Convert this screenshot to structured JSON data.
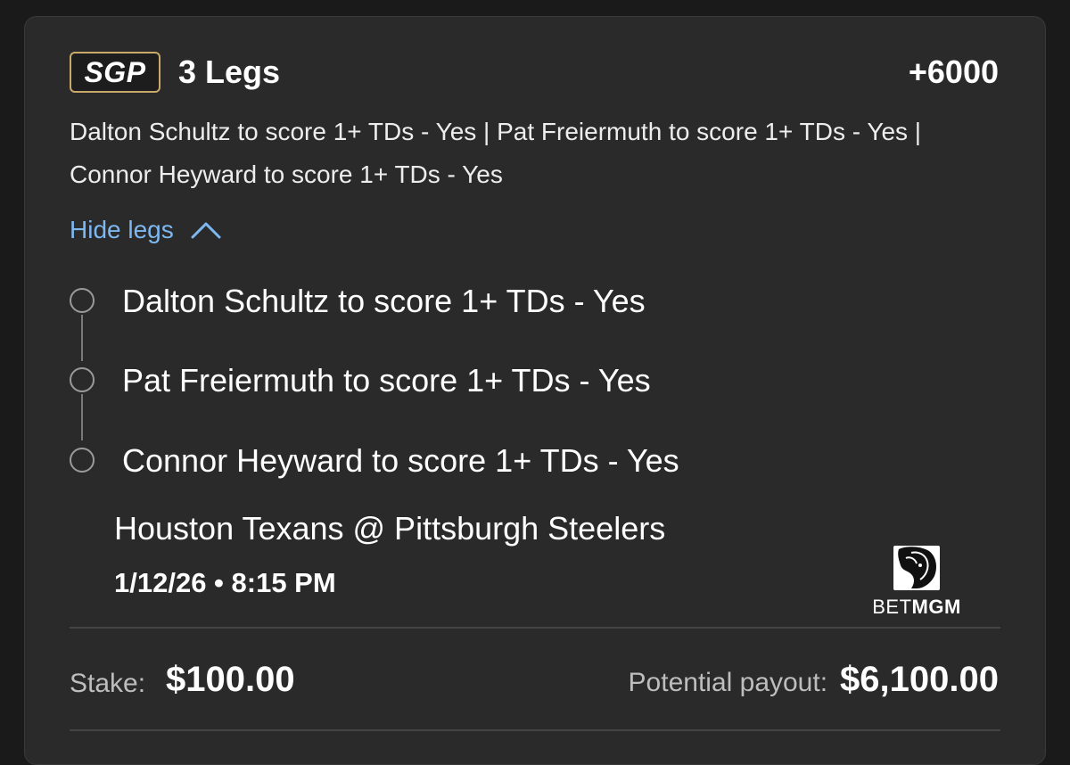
{
  "bet": {
    "badge": "SGP",
    "legs_count": "3 Legs",
    "odds": "+6000",
    "summary": "Dalton Schultz to score 1+ TDs - Yes | Pat Freiermuth to score 1+ TDs - Yes | Connor Heyward to score 1+ TDs - Yes",
    "toggle_label": "Hide legs",
    "legs": [
      {
        "label": "Dalton Schultz to score 1+ TDs - Yes"
      },
      {
        "label": "Pat Freiermuth to score 1+ TDs - Yes"
      },
      {
        "label": "Connor Heyward to score 1+ TDs - Yes"
      }
    ],
    "matchup": "Houston Texans @ Pittsburgh Steelers",
    "datetime": "1/12/26 • 8:15 PM",
    "stake_label": "Stake:",
    "stake_value": "$100.00",
    "payout_label": "Potential payout:",
    "payout_value": "$6,100.00"
  },
  "logo": {
    "brand_prefix": "BET",
    "brand_suffix": "MGM",
    "icon": "lion-icon"
  },
  "colors": {
    "background": "#1a1a1a",
    "card": "#2a2a2a",
    "badge_border": "#c8a96a",
    "link": "#7db8f0",
    "muted_text": "#bdbdbd"
  }
}
